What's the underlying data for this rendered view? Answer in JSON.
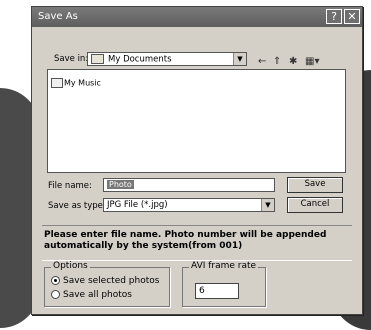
{
  "window": {
    "title": "Save As",
    "help_glyph": "?",
    "close_glyph": "✕"
  },
  "save_in": {
    "label": "Save in:",
    "value": "My Documents",
    "toolbar_icons": [
      "back-arrow-icon",
      "up-folder-icon",
      "new-folder-icon",
      "view-menu-icon"
    ]
  },
  "file_list": {
    "items": [
      {
        "name": "My Music",
        "icon": "music-folder-icon"
      }
    ]
  },
  "file_name": {
    "label": "File name:",
    "value": "Photo"
  },
  "save_as_type": {
    "label": "Save as type:",
    "value": "JPG File (*.jpg)"
  },
  "buttons": {
    "save": "Save",
    "cancel": "Cancel"
  },
  "message": "Please enter file name. Photo number will be appended automatically by the system(from 001)",
  "options": {
    "title": "Options",
    "choices": [
      "Save selected photos",
      "Save all photos"
    ],
    "selected_index": 0
  },
  "avi": {
    "title": "AVI frame rate",
    "value": "6"
  }
}
